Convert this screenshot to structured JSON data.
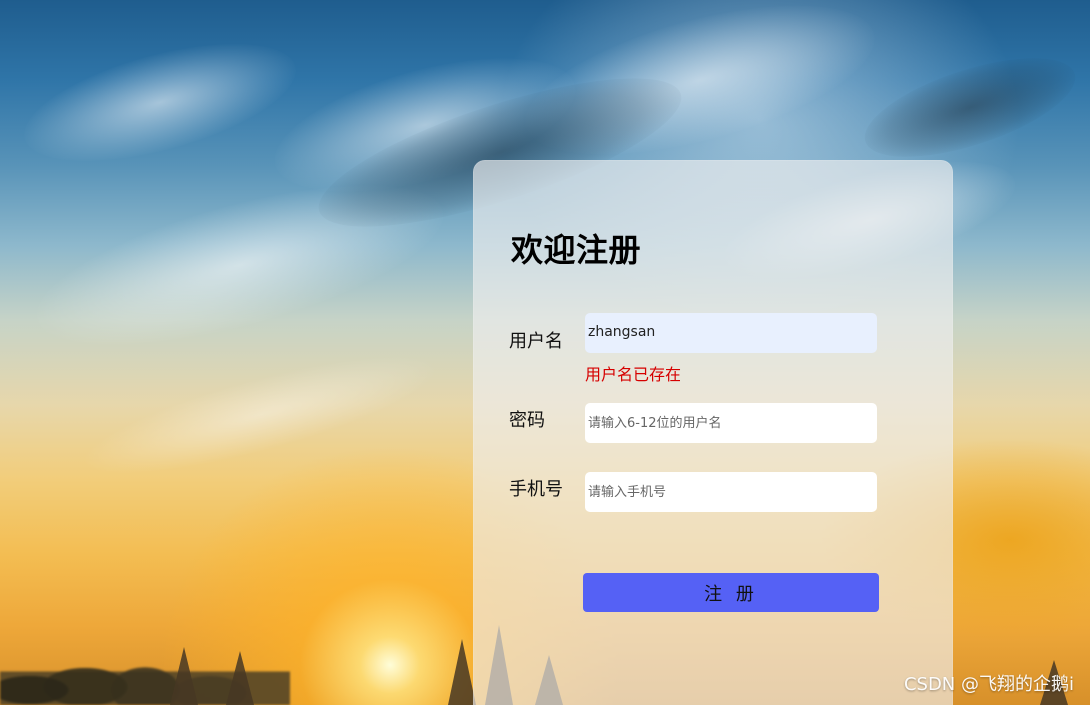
{
  "page": {
    "watermark": "CSDN @飞翔的企鹅i"
  },
  "form": {
    "title": "欢迎注册",
    "fields": {
      "username": {
        "label": "用户名",
        "value": "zhangsan",
        "error": "用户名已存在"
      },
      "password": {
        "label": "密码",
        "placeholder": "请输入6-12位的用户名"
      },
      "phone": {
        "label": "手机号",
        "placeholder": "请输入手机号"
      }
    },
    "submit_label": "注 册"
  },
  "colors": {
    "card_background": "#eeeeee",
    "input_active_background": "#e8f0fe",
    "error": "#d60000",
    "button": "#5561f5"
  }
}
